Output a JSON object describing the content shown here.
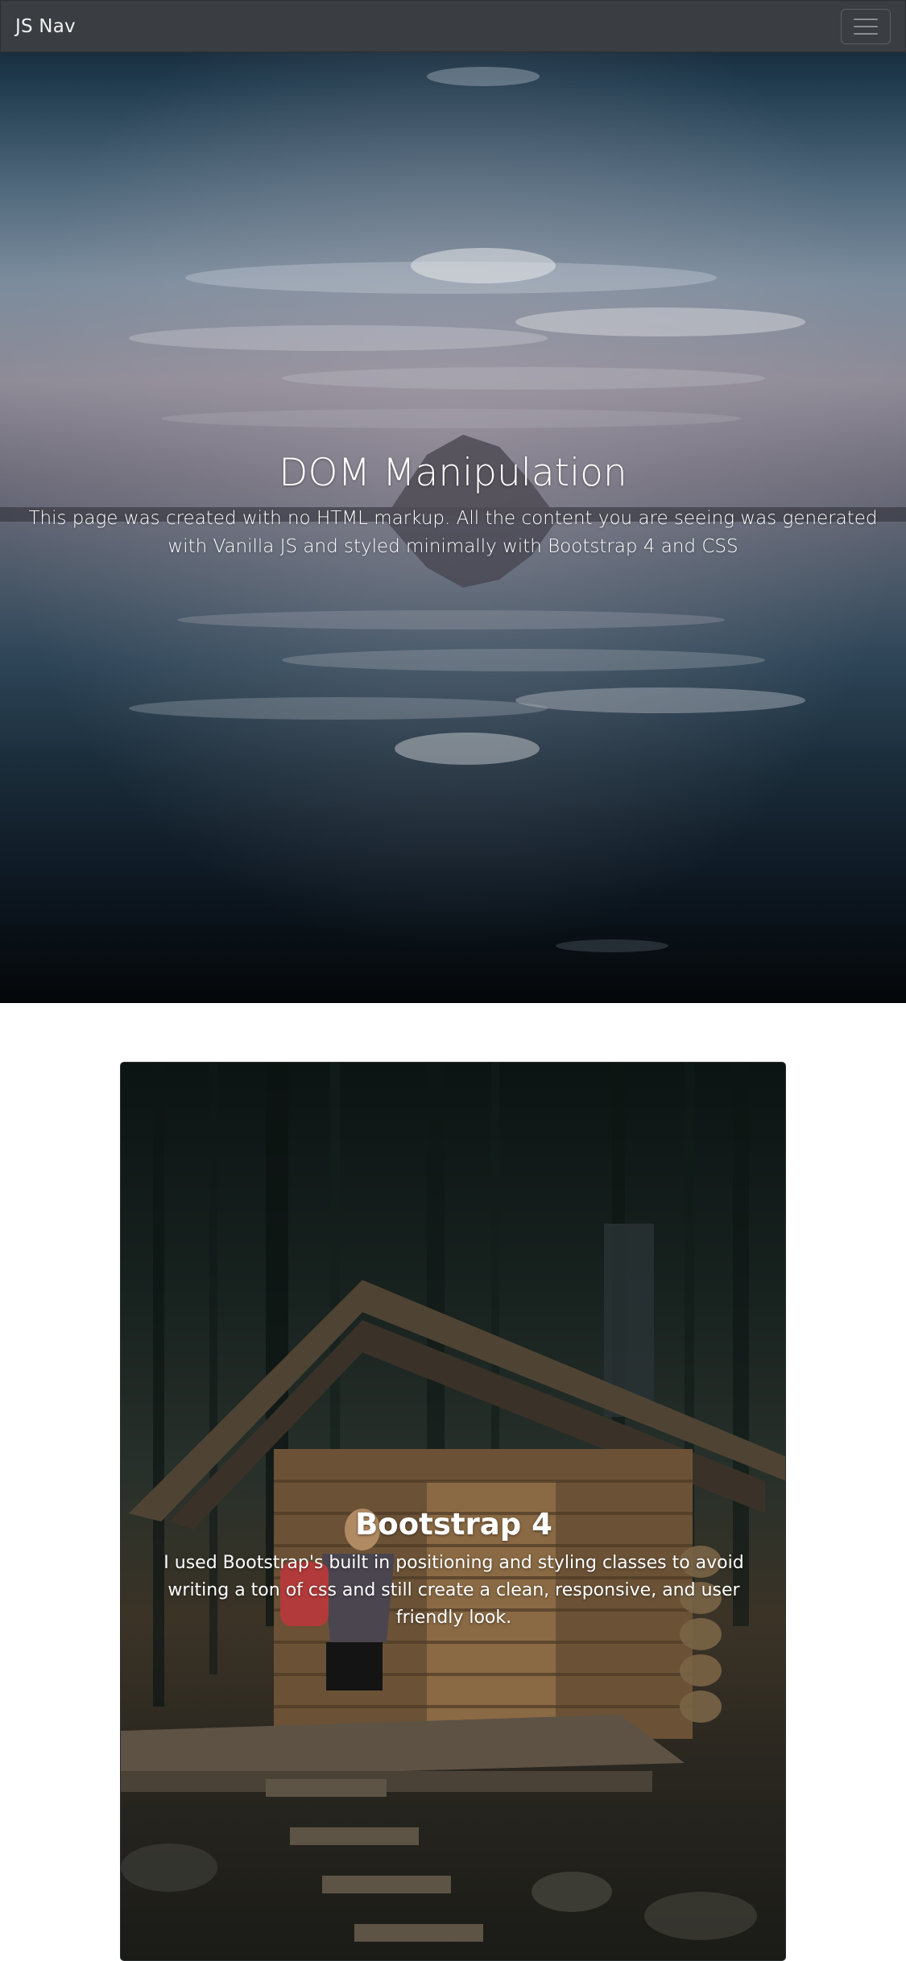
{
  "navbar": {
    "brand": "JS Nav",
    "toggler_icon": "hamburger-menu-icon"
  },
  "hero": {
    "title": "DOM Manipulation",
    "subtitle": "This page was created with no HTML markup. All the content you are seeing was generated with Vanilla JS and styled minimally with Bootstrap 4 and CSS",
    "background": "lake-mountain-reflection-photo"
  },
  "card": {
    "title": "Bootstrap 4",
    "text": "I used Bootstrap's built in positioning and styling classes to avoid writing a ton of css and still create a clean, responsive, and user friendly look.",
    "background": "forest-cabin-hiker-photo"
  },
  "colors": {
    "navbar_bg": "#3a3d42",
    "text_light": "#ffffff",
    "page_bg": "#ffffff"
  }
}
